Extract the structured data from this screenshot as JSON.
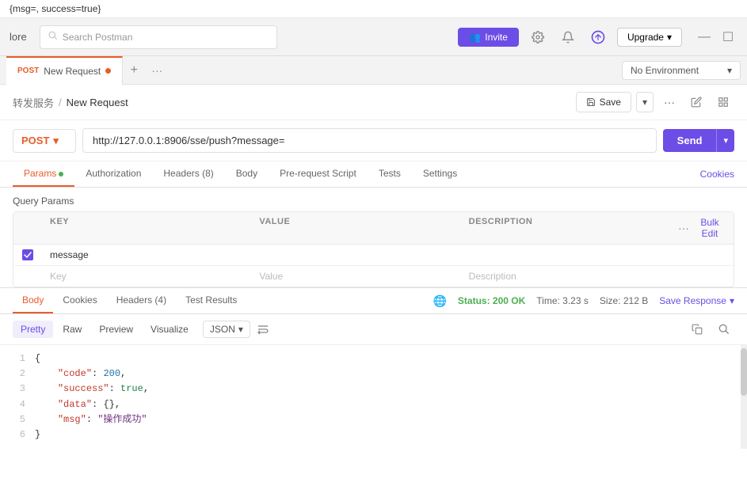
{
  "title_bar": {
    "text": "{msg=, success=true}"
  },
  "top_nav": {
    "app_name": "lore",
    "search_placeholder": "Search Postman",
    "invite_label": "Invite",
    "upgrade_label": "Upgrade"
  },
  "tabs": {
    "active_tab_method": "POST",
    "active_tab_name": "New Request",
    "add_label": "+",
    "more_label": "···",
    "env_label": "No Environment"
  },
  "breadcrumb": {
    "parent": "转发服务",
    "separator": "/",
    "current": "New Request",
    "save_label": "Save",
    "more_label": "···"
  },
  "url_bar": {
    "method": "POST",
    "url": "http://127.0.0.1:8906/sse/push?message=",
    "send_label": "Send"
  },
  "request_tabs": {
    "items": [
      {
        "label": "Params",
        "active": true,
        "has_dot": true
      },
      {
        "label": "Authorization",
        "active": false,
        "has_dot": false
      },
      {
        "label": "Headers (8)",
        "active": false,
        "has_dot": false
      },
      {
        "label": "Body",
        "active": false,
        "has_dot": false
      },
      {
        "label": "Pre-request Script",
        "active": false,
        "has_dot": false
      },
      {
        "label": "Tests",
        "active": false,
        "has_dot": false
      },
      {
        "label": "Settings",
        "active": false,
        "has_dot": false
      }
    ],
    "cookies_label": "Cookies"
  },
  "query_params": {
    "label": "Query Params",
    "headers": {
      "key": "KEY",
      "value": "VALUE",
      "description": "DESCRIPTION",
      "bulk_edit": "Bulk Edit"
    },
    "rows": [
      {
        "checked": true,
        "key": "message",
        "value": "",
        "description": ""
      }
    ],
    "empty_row": {
      "key_placeholder": "Key",
      "value_placeholder": "Value",
      "desc_placeholder": "Description"
    }
  },
  "response": {
    "tabs": [
      {
        "label": "Body",
        "active": true
      },
      {
        "label": "Cookies",
        "active": false
      },
      {
        "label": "Headers (4)",
        "active": false
      },
      {
        "label": "Test Results",
        "active": false
      }
    ],
    "status": "Status: 200 OK",
    "time": "Time: 3.23 s",
    "size": "Size: 212 B",
    "save_response": "Save Response",
    "format_tabs": [
      {
        "label": "Pretty",
        "active": true
      },
      {
        "label": "Raw",
        "active": false
      },
      {
        "label": "Preview",
        "active": false
      },
      {
        "label": "Visualize",
        "active": false
      }
    ],
    "format_select": "JSON",
    "code_lines": [
      {
        "num": "1",
        "content": "{"
      },
      {
        "num": "2",
        "content": "    \"code\": 200,"
      },
      {
        "num": "3",
        "content": "    \"success\": true,"
      },
      {
        "num": "4",
        "content": "    \"data\": {},"
      },
      {
        "num": "5",
        "content": "    \"msg\": \"操作成功\""
      },
      {
        "num": "6",
        "content": "}"
      }
    ]
  }
}
